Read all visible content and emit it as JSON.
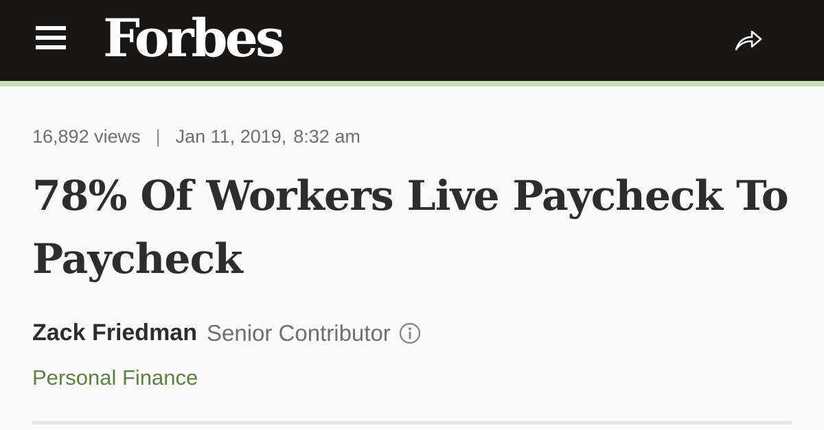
{
  "header": {
    "menu_icon": "hamburger-menu-icon",
    "logo_text": "Forbes",
    "share_icon": "share-arrow-icon",
    "background_color": "#181716",
    "accent_color": "#c6e0b4"
  },
  "article": {
    "views": "16,892 views",
    "separator": "|",
    "date": "Jan 11, 2019,",
    "time": "8:32 am",
    "headline": "78% Of Workers Live Paycheck To Paycheck",
    "author": {
      "name": "Zack Friedman",
      "role": "Senior Contributor",
      "info_icon": "info-circle-icon"
    },
    "channel": "Personal Finance",
    "channel_color": "#5f7f44"
  }
}
